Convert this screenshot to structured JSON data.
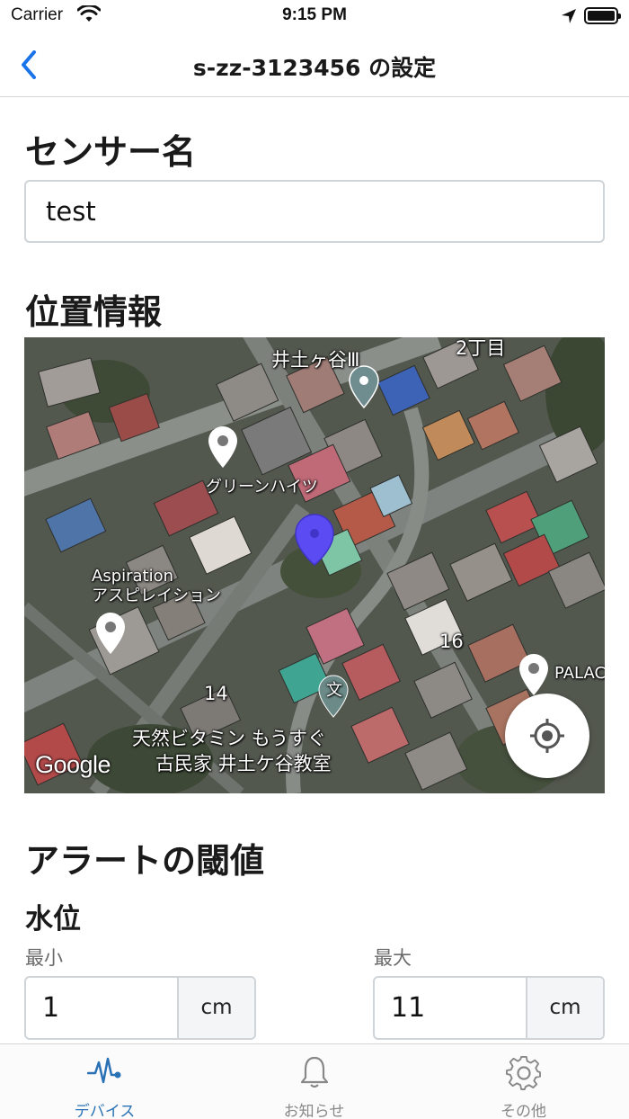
{
  "status_bar": {
    "carrier": "Carrier",
    "time": "9:15 PM"
  },
  "nav": {
    "title": "s-zz-3123456 の設定",
    "back_icon": "chevron-left-icon",
    "accent": "#1a73e8"
  },
  "sensor_name": {
    "heading": "センサー名",
    "value": "test"
  },
  "location": {
    "heading": "位置情報",
    "map_labels": {
      "top_building": "井土ヶ谷Ⅲ",
      "chome": "2丁目",
      "green_heights": "グリーンハイツ",
      "aspiration_en": "Aspiration",
      "aspiration_jp": "アスピレイション",
      "num16": "16",
      "num14": "14",
      "palace": "PALAC",
      "vitamin": "天然ビタミン もうすぐ",
      "kominka": "古民家 井土ケ谷教室",
      "school_glyph": "文"
    },
    "google_logo": "Google",
    "marker_color": "#5a4cf2"
  },
  "alert": {
    "heading": "アラートの閾値",
    "water_level": {
      "heading": "水位",
      "min": {
        "label": "最小",
        "value": "1",
        "unit": "cm"
      },
      "max": {
        "label": "最大",
        "value": "11",
        "unit": "cm"
      }
    }
  },
  "tabs": [
    {
      "label": "デバイス",
      "icon": "pulse-icon",
      "active": true
    },
    {
      "label": "お知らせ",
      "icon": "bell-icon",
      "active": false
    },
    {
      "label": "その他",
      "icon": "gear-icon",
      "active": false
    }
  ]
}
